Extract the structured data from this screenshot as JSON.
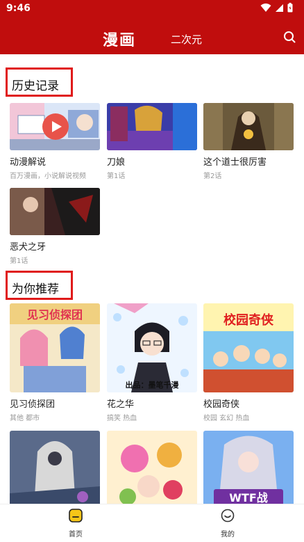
{
  "status": {
    "time": "9:46"
  },
  "appbar": {
    "title": "漫画",
    "tab": "二次元"
  },
  "sections": {
    "history": {
      "title": "历史记录",
      "items": [
        {
          "title": "动漫解说",
          "sub": "百万漫画，小说解说视频"
        },
        {
          "title": "刀娘",
          "sub": "第1话"
        },
        {
          "title": "这个道士很厉害",
          "sub": "第2话"
        },
        {
          "title": "恶犬之牙",
          "sub": "第1话"
        }
      ]
    },
    "recommend": {
      "title": "为你推荐",
      "items": [
        {
          "title": "见习侦探团",
          "sub": "其他 都市"
        },
        {
          "title": "花之华",
          "sub": "搞笑 热血"
        },
        {
          "title": "校园奇侠",
          "sub": "校园 玄幻 热血"
        },
        {
          "title": "",
          "sub": ""
        },
        {
          "title": "",
          "sub": ""
        },
        {
          "title": "",
          "sub": ""
        }
      ]
    }
  },
  "covers": {
    "c1_text": "见习侦探团",
    "c2_text": "出品：墨笔千漫",
    "c3_text": "校园奇侠",
    "c6_text": "WTF战"
  },
  "bottom_nav": {
    "home": "首页",
    "mine": "我的"
  },
  "colors": {
    "brand_red": "#c00d0d",
    "highlight_box": "#e01a1a"
  }
}
